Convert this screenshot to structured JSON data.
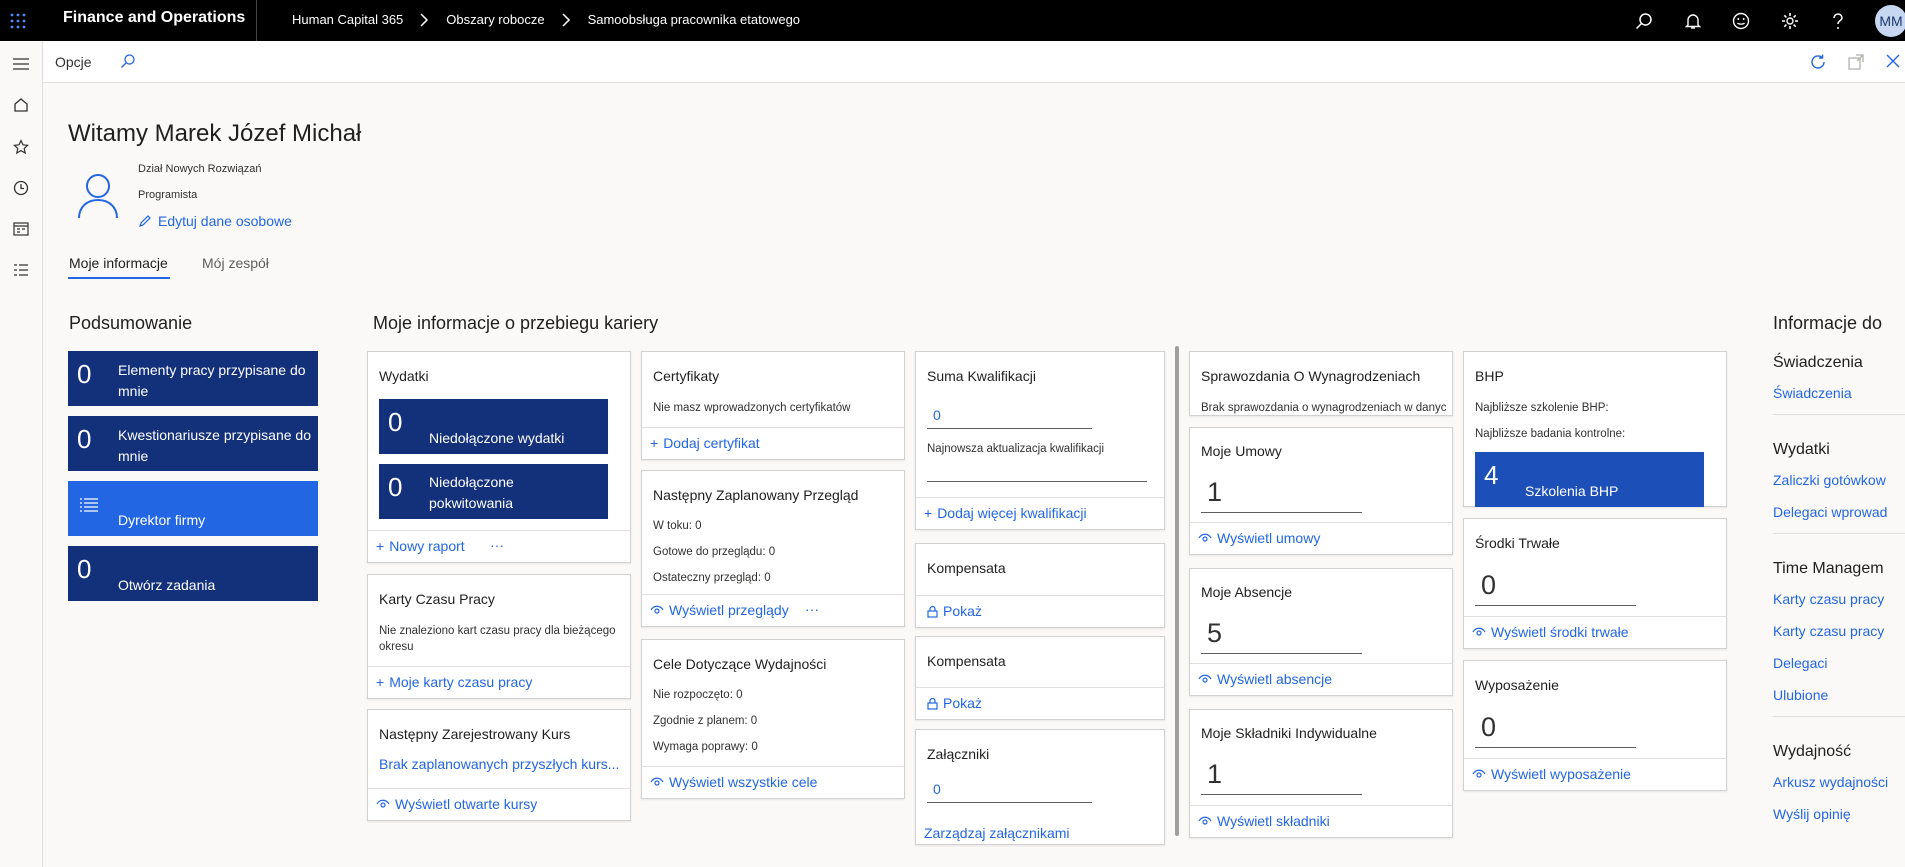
{
  "topbar": {
    "app_name": "Finance and Operations",
    "breadcrumbs": [
      "Human Capital 365",
      "Obszary robocze",
      "Samoobsługa pracownika etatowego"
    ],
    "avatar": "MM"
  },
  "actionbar": {
    "options_label": "Opcje"
  },
  "header": {
    "welcome": "Witamy Marek Józef Michał",
    "department": "Dział Nowych Rozwiązań",
    "position": "Programista",
    "edit_link": "Edytuj dane osobowe"
  },
  "tabs": [
    "Moje informacje",
    "Mój zespół"
  ],
  "summary": {
    "title": "Podsumowanie",
    "tiles": [
      {
        "count": "0",
        "label": "Elementy pracy przypisane do mnie"
      },
      {
        "count": "0",
        "label": "Kwestionariusze przypisane do mnie"
      },
      {
        "count": "",
        "label": "Dyrektor firmy"
      },
      {
        "count": "0",
        "label": "Otwórz zadania"
      }
    ]
  },
  "career": {
    "title": "Moje informacje o przebiegu kariery"
  },
  "wydatki": {
    "title": "Wydatki",
    "tile1_count": "0",
    "tile1_label": "Niedołączone wydatki",
    "tile2_count": "0",
    "tile2_label": "Niedołączone pokwitowania",
    "action": "Nowy raport",
    "more": "···"
  },
  "karty": {
    "title": "Karty Czasu Pracy",
    "text": "Nie znaleziono kart czasu pracy dla bieżącego okresu",
    "action": "Moje karty czasu pracy"
  },
  "kurs": {
    "title": "Następny Zarejestrowany Kurs",
    "link": "Brak zaplanowanych przyszłych kurs...",
    "action": "Wyświetl otwarte kursy"
  },
  "certyfikaty": {
    "title": "Certyfikaty",
    "text": "Nie masz wprowadzonych certyfikatów",
    "action": "Dodaj certyfikat"
  },
  "przeglad": {
    "title": "Następny Zaplanowany Przegląd",
    "line1": "W toku: 0",
    "line2": "Gotowe do przeglądu: 0",
    "line3": "Ostateczny przegląd: 0",
    "action": "Wyświetl przeglądy",
    "more": "···"
  },
  "cele": {
    "title": "Cele Dotyczące Wydajności",
    "line1": "Nie rozpoczęto: 0",
    "line2": "Zgodnie z planem: 0",
    "line3": "Wymaga poprawy: 0",
    "action": "Wyświetl wszystkie cele"
  },
  "kwalifikacje": {
    "title": "Suma Kwalifikacji",
    "value": "0",
    "sub": "Najnowsza aktualizacja kwalifikacji",
    "action": "Dodaj więcej kwalifikacji"
  },
  "kompensata1": {
    "title": "Kompensata",
    "action": "Pokaż"
  },
  "kompensata2": {
    "title": "Kompensata",
    "action": "Pokaż"
  },
  "zalaczniki": {
    "title": "Załączniki",
    "value": "0",
    "action": "Zarządzaj załącznikami"
  },
  "sprawozdania": {
    "title": "Sprawozdania O Wynagrodzeniach",
    "text": "Brak sprawozdania o wynagrodzeniach w danyc"
  },
  "umowy": {
    "title": "Moje Umowy",
    "value": "1",
    "action": "Wyświetl umowy"
  },
  "absencje": {
    "title": "Moje Absencje",
    "value": "5",
    "action": "Wyświetl absencje"
  },
  "skladniki": {
    "title": "Moje Składniki Indywidualne",
    "value": "1",
    "action": "Wyświetl składniki"
  },
  "bhp": {
    "title": "BHP",
    "line1": "Najbliższe szkolenie BHP:",
    "line2": "Najbliższe badania kontrolne:",
    "tile_count": "4",
    "tile_label": "Szkolenia BHP"
  },
  "srodki": {
    "title": "Środki Trwałe",
    "value": "0",
    "action": "Wyświetl środki trwałe"
  },
  "wyposazenie": {
    "title": "Wyposażenie",
    "value": "0",
    "action": "Wyświetl wyposażenie"
  },
  "right": {
    "title": "Informacje do",
    "swiadczenia_head": "Świadczenia",
    "swiadczenia_link": "Świadczenia",
    "wydatki_head": "Wydatki",
    "wydatki_links": [
      "Zaliczki gotówkow",
      "Delegaci wprowad"
    ],
    "time_head": "Time Managem",
    "time_links": [
      "Karty czasu pracy",
      "Karty czasu pracy",
      "Delegaci",
      "Ulubione"
    ],
    "wyd_head": "Wydajność",
    "wyd_links": [
      "Arkusz wydajności",
      "Wyślij opinię"
    ]
  },
  "colors": {
    "tile_dark": "#13307b",
    "tile_active": "#2266e3",
    "link": "#2266e3"
  }
}
